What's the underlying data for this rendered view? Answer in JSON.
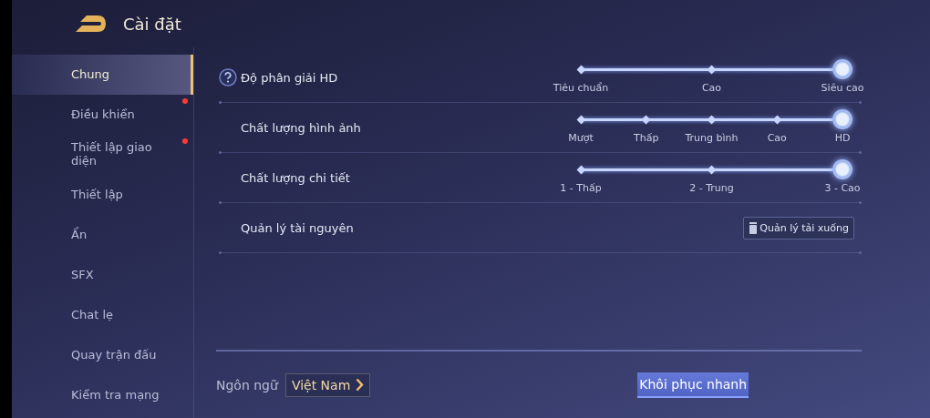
{
  "header": {
    "title": "Cài đặt"
  },
  "sidebar": {
    "items": [
      {
        "label": "Chung",
        "selected": true,
        "notification": false
      },
      {
        "label": "Điều khiển",
        "selected": false,
        "notification": true
      },
      {
        "label": "Thiết lập giao diện",
        "selected": false,
        "notification": true
      },
      {
        "label": "Thiết lập",
        "selected": false,
        "notification": false
      },
      {
        "label": "Ẩn",
        "selected": false,
        "notification": false
      },
      {
        "label": "SFX",
        "selected": false,
        "notification": false
      },
      {
        "label": "Chat lẹ",
        "selected": false,
        "notification": false
      },
      {
        "label": "Quay trận đấu",
        "selected": false,
        "notification": false
      },
      {
        "label": "Kiểm tra mạng",
        "selected": false,
        "notification": false
      }
    ]
  },
  "settings": [
    {
      "kind": "slider",
      "label": "Độ phân giải HD",
      "help": true,
      "level": 1,
      "options": [
        "Tiêu chuẩn",
        "Cao",
        "Siêu cao"
      ]
    },
    {
      "kind": "slider",
      "label": "Chất lượng hình ảnh",
      "help": false,
      "level": 1,
      "options": [
        "Mượt",
        "Thấp",
        "Trung bình",
        "Cao",
        "HD"
      ]
    },
    {
      "kind": "slider",
      "label": "Chất lượng chi tiết",
      "help": false,
      "level": 1,
      "options": [
        "1 - Thấp",
        "2 - Trung",
        "3 - Cao"
      ]
    },
    {
      "kind": "button",
      "label": "Quản lý tài nguyên",
      "help": false,
      "button": "Quản lý tải xuống"
    }
  ],
  "footer": {
    "language_label": "Ngôn ngữ",
    "language": "Việt Nam",
    "reset_button": "Khôi phục nhanh"
  }
}
